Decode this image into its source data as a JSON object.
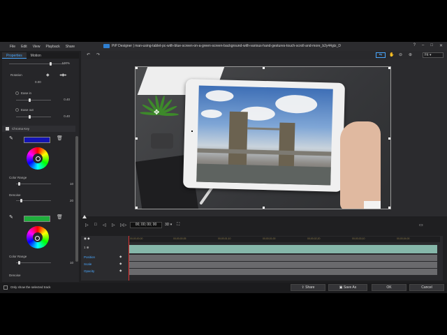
{
  "window": {
    "title": "PiP Designer | man-using-tablet-pc-with-blue-screen-on-a-green-screen-background-with-various-hand-gestures-touch-scroll-and-more_b2y44gtz_D",
    "menu": [
      "File",
      "Edit",
      "View",
      "Playback",
      "Share"
    ],
    "controls": [
      "?",
      "–",
      "□",
      "✕"
    ]
  },
  "left_panel": {
    "tabs": [
      "Properties",
      "Motion"
    ],
    "top_value": "100%",
    "rotation": {
      "label": "Rotation",
      "value": "0.00"
    },
    "ease_in": {
      "label": "Ease in",
      "value": "0.40",
      "level": 0.4
    },
    "ease_out": {
      "label": "Ease out",
      "value": "0.40",
      "level": 0.4
    },
    "chroma_key": {
      "label": "Chroma Key",
      "checked": true
    },
    "key1": {
      "swatch": "#1414b4",
      "color_range_label": "Color Range",
      "color_range": "10",
      "color_range_level": 0.1,
      "denoise_label": "Denoise",
      "denoise": "20",
      "denoise_level": 0.2
    },
    "key2": {
      "swatch": "#1fae3c",
      "color_range_label": "Color Range",
      "color_range": "10",
      "color_range_level": 0.1,
      "denoise_label": "Denoise"
    }
  },
  "toolbar": {
    "fit": "Fit"
  },
  "playback": {
    "timecode": "00; 00; 00; 00",
    "mode": "3D"
  },
  "timeline": {
    "ticks": [
      "00;00;00;00",
      "00;00;00;05",
      "00;00;01;10",
      "00;00;01;00",
      "00;00;02;20",
      "00;00;03;10",
      "00;00;04;00"
    ],
    "rows": [
      "Position",
      "Scale",
      "Opacity"
    ]
  },
  "bottom": {
    "only_show_label": "Only show the selected track",
    "share": "Share",
    "save_as": "Save As",
    "ok": "OK",
    "cancel": "Cancel"
  }
}
